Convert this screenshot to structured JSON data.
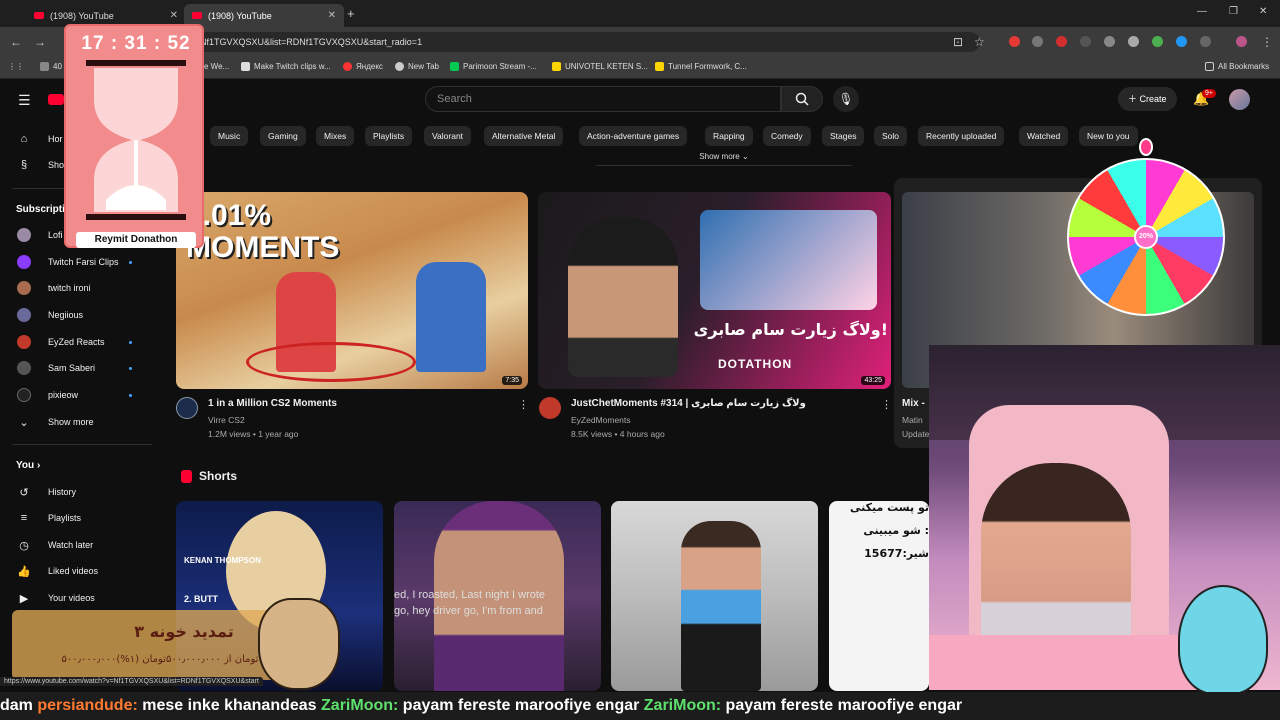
{
  "browser": {
    "tabs": [
      {
        "title": "(1908) YouTube",
        "active": false
      },
      {
        "title": "(1908) YouTube",
        "active": true
      }
    ],
    "url": "Nf1TGVXQSXU&list=RDNf1TGVXQSXU&start_radio=1",
    "bookmarks": [
      {
        "label": "40",
        "icon_color": "#888888"
      },
      {
        "label": "e We...",
        "icon_color": "#4285f4"
      },
      {
        "label": "Make Twitch clips w...",
        "icon_color": "#dddddd"
      },
      {
        "label": "Яндекс",
        "icon_color": "#ff3333"
      },
      {
        "label": "New Tab",
        "icon_color": "#cccccc"
      },
      {
        "label": "Parimoon Stream -...",
        "icon_color": "#00c853"
      },
      {
        "label": "UNIVOTEL KETEN S...",
        "icon_color": "#ffd600"
      },
      {
        "label": "Tunnel Formwork, C...",
        "icon_color": "#ffd600"
      }
    ],
    "all_bookmarks": "All Bookmarks"
  },
  "topbar": {
    "search_placeholder": "Search",
    "create_label": "Create",
    "notif_badge": "9+"
  },
  "sidebar": {
    "top_items": [
      {
        "label": "Hor",
        "icon": "home-icon"
      },
      {
        "label": "Sho",
        "icon": "shorts-icon"
      }
    ],
    "subs_header": "Subscripti",
    "subscriptions": [
      {
        "label": "Lofi",
        "color": "#9a8aa6",
        "dot": false
      },
      {
        "label": "Twitch Farsi Clips",
        "color": "#8a3cff",
        "dot": true
      },
      {
        "label": "twitch ironi",
        "color": "#a86b4d",
        "dot": false
      },
      {
        "label": "Negiious",
        "color": "#6a6a9a",
        "dot": false
      },
      {
        "label": "EyZed Reacts",
        "color": "#c0392b",
        "dot": true
      },
      {
        "label": "Sam Saberi",
        "color": "#555555",
        "dot": true
      },
      {
        "label": "pixieow",
        "color": "#222222",
        "dot": true
      }
    ],
    "show_more": "Show more",
    "you_header": "You",
    "you_items": [
      {
        "label": "History",
        "icon": "history-icon"
      },
      {
        "label": "Playlists",
        "icon": "playlists-icon"
      },
      {
        "label": "Watch later",
        "icon": "clock-icon"
      },
      {
        "label": "Liked videos",
        "icon": "thumbs-up-icon"
      },
      {
        "label": "Your videos",
        "icon": "video-icon"
      }
    ]
  },
  "chips": [
    "Music",
    "Gaming",
    "Mixes",
    "Playlists",
    "Valorant",
    "Alternative Metal",
    "Action-adventure games",
    "Rapping",
    "Comedy",
    "Stages",
    "Solo",
    "Recently uploaded",
    "Watched",
    "New to you"
  ],
  "show_more_chips": "Show more",
  "videos": [
    {
      "title": "1 in a Million CS2 Moments",
      "channel": "Virre CS2",
      "meta": "1.2M views • 1 year ago",
      "duration": "7:35",
      "thumb_text": "0.01% MOMENTS"
    },
    {
      "title": "JustChetMoments #314 | ولاگ زیارت سام صابری",
      "channel": "EyZedMoments",
      "meta": "8.5K views • 4 hours ago",
      "duration": "43:25",
      "thumb_text": "ولاگ زیارت سام صابری!",
      "thumb_text2": "DOTATHON"
    },
    {
      "title": "Mix -",
      "channel": "Matin",
      "meta": "Update"
    }
  ],
  "shorts": {
    "header": "Shorts",
    "items": [
      {
        "text1": "KENAN THOMPSON",
        "text2": "2. BUTT"
      },
      {
        "text1": "ed, I roasted, Last night I wrote",
        "text2": "go, hey driver go, I'm from and"
      },
      {
        "text1": ""
      },
      {
        "text1": "تو پست میکنی",
        "text2": "شو میبینی :",
        "text3": "شیر:15677"
      }
    ]
  },
  "overlays": {
    "timer": "17 : 31 : 52",
    "timer_label": "Reymit Donathon",
    "wheel_center": "20%",
    "donate_title": "تمدید خونه ۳",
    "donate_sub": "۵۰۰٫۰۰۰٫۰۰۰تومان از ۵۰۰٫۰۰۰٫۰۰۰تومان (۱%)"
  },
  "status_url": "https://www.youtube.com/watch?v=Nf1TGVXQSXU&list=RDNf1TGVXQSXU&start",
  "ticker": [
    {
      "user": "",
      "msg": "dam "
    },
    {
      "user": "persiandude:",
      "msg": " mese inke khanandeas "
    },
    {
      "user": "ZariMoon:",
      "msg": " payam fereste maroofiye engar "
    },
    {
      "user": "ZariMoon:",
      "msg": " payam fereste maroofiye engar"
    }
  ]
}
